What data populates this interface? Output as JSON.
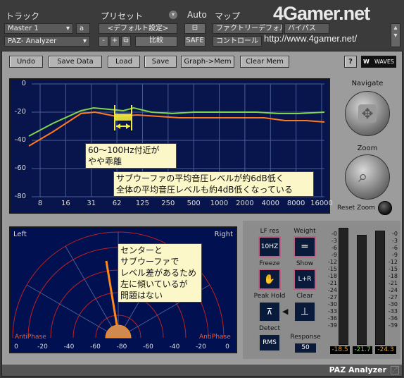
{
  "host": {
    "track_label": "トラック",
    "preset_label": "プリセット",
    "auto_label": "Auto",
    "map_label": "マップ",
    "track_name": "Master 1",
    "track_channel": "a",
    "plugin_name": "PAZ- Analyzer",
    "preset_name": "<デフォルト設定>",
    "minus": "-",
    "plus": "+",
    "compare": "比較",
    "safe": "SAFE",
    "factory": "ファクトリーデフォルト",
    "bypass": "バイパス",
    "control": "コントロール",
    "watermark": "4Gamer.net",
    "watermark_url": "http://www.4gamer.net/"
  },
  "toolbar": {
    "undo": "Undo",
    "save_data": "Save Data",
    "load": "Load",
    "save": "Save",
    "graph_mem": "Graph->Mem",
    "clear_mem": "Clear Mem",
    "help": "?",
    "brand": "WAVES"
  },
  "freq_plot": {
    "y_labels": [
      "0",
      "-20",
      "-40",
      "-60",
      "-80"
    ],
    "x_labels": [
      "8",
      "16",
      "31",
      "62",
      "125",
      "250",
      "500",
      "1000",
      "2000",
      "4000",
      "8000",
      "16000"
    ],
    "colors": {
      "green": "#7ed64a",
      "orange": "#ff7a1a",
      "bg": "#08154d",
      "grid": "#4a5d96"
    }
  },
  "callouts": {
    "low": [
      "60～100Hz付近が",
      "やや乖離"
    ],
    "avg": [
      "サブウーファの平均音圧レベルが約6dB低く",
      "全体の平均音圧レベルも約4dB低くなっている"
    ],
    "scope": [
      "センターと",
      "サブウーファで",
      "レベル差があるため",
      "左に傾いているが",
      "問題はない"
    ]
  },
  "navigate": {
    "title": "Navigate",
    "zoom": "Zoom",
    "reset_zoom": "Reset Zoom"
  },
  "scope": {
    "left": "Left",
    "right": "Right",
    "antiphase_left": "AntiPhase",
    "antiphase_right": "AntiPhase",
    "x_labels": [
      "0",
      "-20",
      "-40",
      "-60",
      "-80",
      "-60",
      "-40",
      "-20",
      "0"
    ]
  },
  "controls": {
    "lf_res": "LF res",
    "lf_res_value": "10HZ",
    "weight": "Weight",
    "freeze": "Freeze",
    "show": "Show",
    "show_value": "L+R",
    "peak_hold": "Peak Hold",
    "clear": "Clear",
    "detect": "Detect",
    "detect_value": "RMS",
    "response": "Response",
    "response_value": "50"
  },
  "meters": {
    "scale": [
      "-0",
      "-3",
      "-6",
      "-9",
      "-12",
      "-15",
      "-18",
      "-21",
      "-24",
      "-27",
      "-30",
      "-33",
      "-36",
      "-39"
    ],
    "peaks": [
      "-18.5",
      "-21.7",
      "-24.3"
    ]
  },
  "footer": {
    "title": "PAZ Analyzer"
  }
}
